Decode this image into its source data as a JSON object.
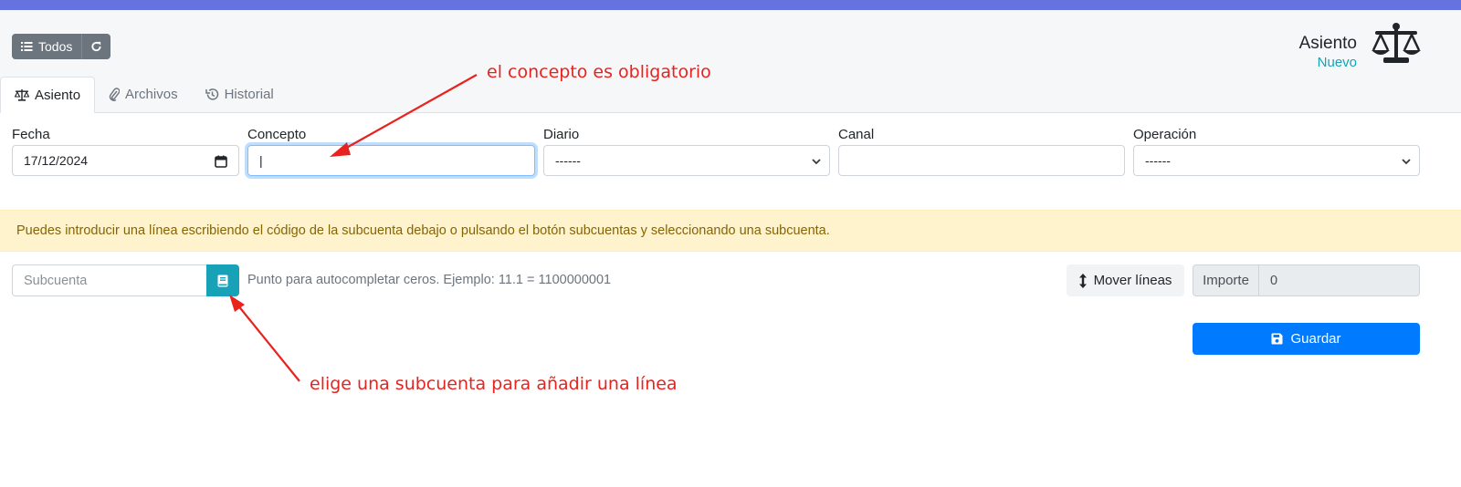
{
  "header": {
    "todos_label": "Todos",
    "title": "Asiento",
    "subtitle": "Nuevo",
    "accent_color": "#6573e0"
  },
  "tabs": [
    {
      "label": "Asiento",
      "icon": "scale-icon",
      "active": true
    },
    {
      "label": "Archivos",
      "icon": "paperclip-icon",
      "active": false
    },
    {
      "label": "Historial",
      "icon": "history-icon",
      "active": false
    }
  ],
  "form": {
    "fecha": {
      "label": "Fecha",
      "value": "17/12/2024"
    },
    "concepto": {
      "label": "Concepto",
      "value": "|"
    },
    "diario": {
      "label": "Diario",
      "value": "------"
    },
    "canal": {
      "label": "Canal",
      "value": ""
    },
    "operacion": {
      "label": "Operación",
      "value": "------"
    }
  },
  "alert": {
    "text": "Puedes introducir una línea escribiendo el código de la subcuenta debajo o pulsando el botón subcuentas y seleccionando una subcuenta."
  },
  "lines": {
    "subcuenta_placeholder": "Subcuenta",
    "hint": "Punto para autocompletar ceros. Ejemplo: 11.1 = 1100000001",
    "mover_label": "Mover líneas",
    "importe_label": "Importe",
    "importe_value": "0",
    "guardar_label": "Guardar"
  },
  "annotations": {
    "concepto_note": "el concepto es obligatorio",
    "subcuenta_note": "elige una subcuenta para añadir una línea"
  }
}
